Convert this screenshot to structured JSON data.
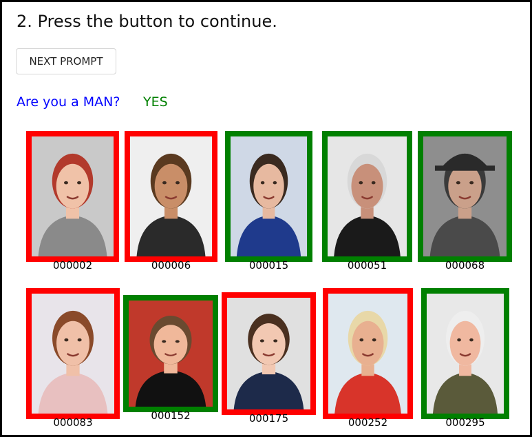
{
  "instruction": "2. Press the button to continue.",
  "next_button_label": "NEXT PROMPT",
  "question": {
    "label": "Are you a MAN?",
    "answer": "YES"
  },
  "colors": {
    "no": "#ff0000",
    "yes": "#008000",
    "question": "#0000ff",
    "answer": "#008000"
  },
  "faces": [
    {
      "id": "000002",
      "verdict": "no"
    },
    {
      "id": "000006",
      "verdict": "no"
    },
    {
      "id": "000015",
      "verdict": "yes"
    },
    {
      "id": "000051",
      "verdict": "yes"
    },
    {
      "id": "000068",
      "verdict": "yes"
    },
    {
      "id": "000083",
      "verdict": "no"
    },
    {
      "id": "000152",
      "verdict": "yes"
    },
    {
      "id": "000175",
      "verdict": "no"
    },
    {
      "id": "000252",
      "verdict": "no"
    },
    {
      "id": "000295",
      "verdict": "yes"
    }
  ]
}
